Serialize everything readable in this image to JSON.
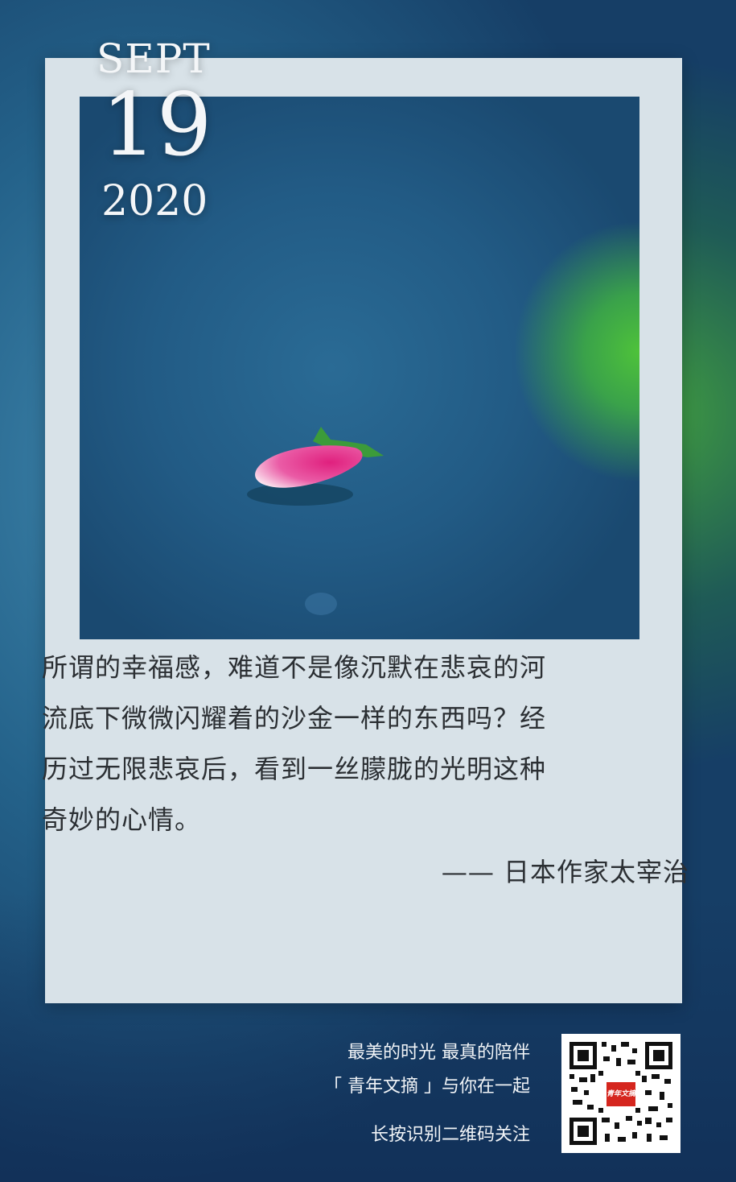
{
  "date": {
    "month": "SEPT",
    "day": "19",
    "year": "2020"
  },
  "quote": {
    "line1": "所谓的幸福感，难道不是像沉默在悲哀的河",
    "line2": "流底下微微闪耀着的沙金一样的东西吗？经",
    "line3": "历过无限悲哀后，看到一丝朦胧的光明这种",
    "line4": "奇妙的心情。",
    "author": "—— 日本作家太宰治"
  },
  "footer": {
    "line1": "最美的时光  最真的陪伴",
    "line2": "「 青年文摘 」与你在一起",
    "line3": "长按识别二维码关注",
    "qr_logo": "青年文摘"
  }
}
